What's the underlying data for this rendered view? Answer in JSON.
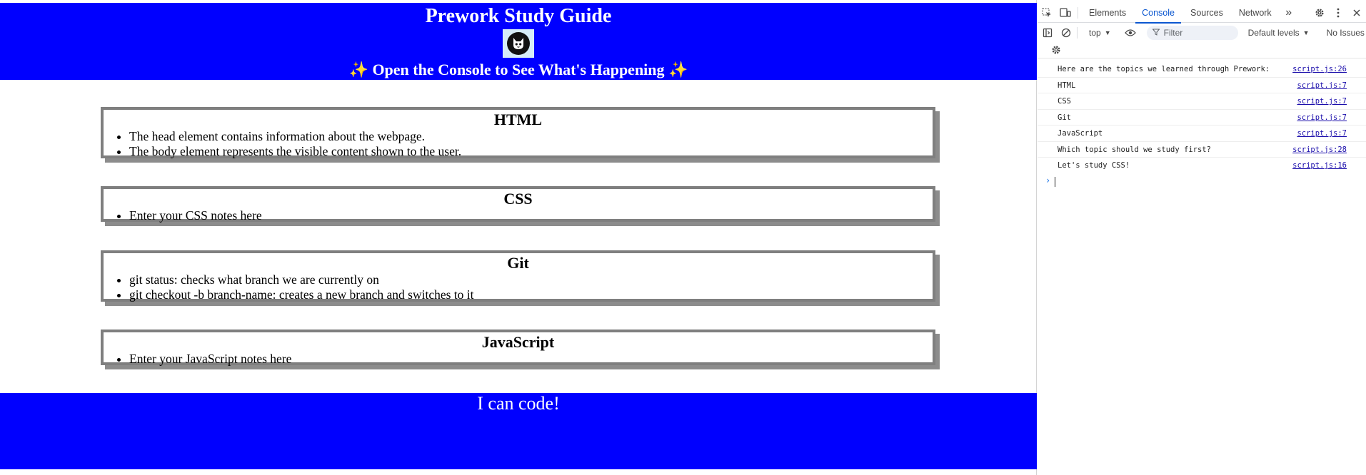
{
  "page": {
    "header": {
      "title": "Prework Study Guide",
      "subtitle_sparkle_left": "✨",
      "subtitle": " Open the Console to See What's Happening ",
      "subtitle_sparkle_right": "✨",
      "logo_icon": "cat-face-icon"
    },
    "sections": [
      {
        "title": "HTML",
        "items": [
          "The head element contains information about the webpage.",
          "The body element represents the visible content shown to the user."
        ]
      },
      {
        "title": "CSS",
        "items": [
          "Enter your CSS notes here"
        ]
      },
      {
        "title": "Git",
        "items": [
          "git status: checks what branch we are currently on",
          "git checkout -b branch-name: creates a new branch and switches to it"
        ]
      },
      {
        "title": "JavaScript",
        "items": [
          "Enter your JavaScript notes here"
        ]
      }
    ],
    "footer": {
      "text": "I can code!"
    },
    "colors": {
      "banner": "#0000ff",
      "card_border": "#7f7f7f",
      "card_shadow": "#8c8c8c",
      "logo_bg": "#d6ecf8"
    }
  },
  "devtools": {
    "tabs": [
      {
        "label": "Elements",
        "active": false
      },
      {
        "label": "Console",
        "active": true
      },
      {
        "label": "Sources",
        "active": false
      },
      {
        "label": "Network",
        "active": false
      }
    ],
    "more_tabs": "»",
    "toolbar": {
      "context": "top",
      "filter_placeholder": "Filter",
      "levels": "Default levels",
      "issues": "No Issues"
    },
    "console_lines": [
      {
        "message": "Here are the topics we learned through Prework:",
        "source": "script.js:26"
      },
      {
        "message": "HTML",
        "source": "script.js:7"
      },
      {
        "message": "CSS",
        "source": "script.js:7"
      },
      {
        "message": "Git",
        "source": "script.js:7"
      },
      {
        "message": "JavaScript",
        "source": "script.js:7"
      },
      {
        "message": "Which topic should we study first?",
        "source": "script.js:28"
      },
      {
        "message": "Let's study CSS!",
        "source": "script.js:16"
      }
    ],
    "prompt_symbol": "›",
    "colors": {
      "accent": "#0b57d0",
      "link": "#1a0dab"
    }
  }
}
